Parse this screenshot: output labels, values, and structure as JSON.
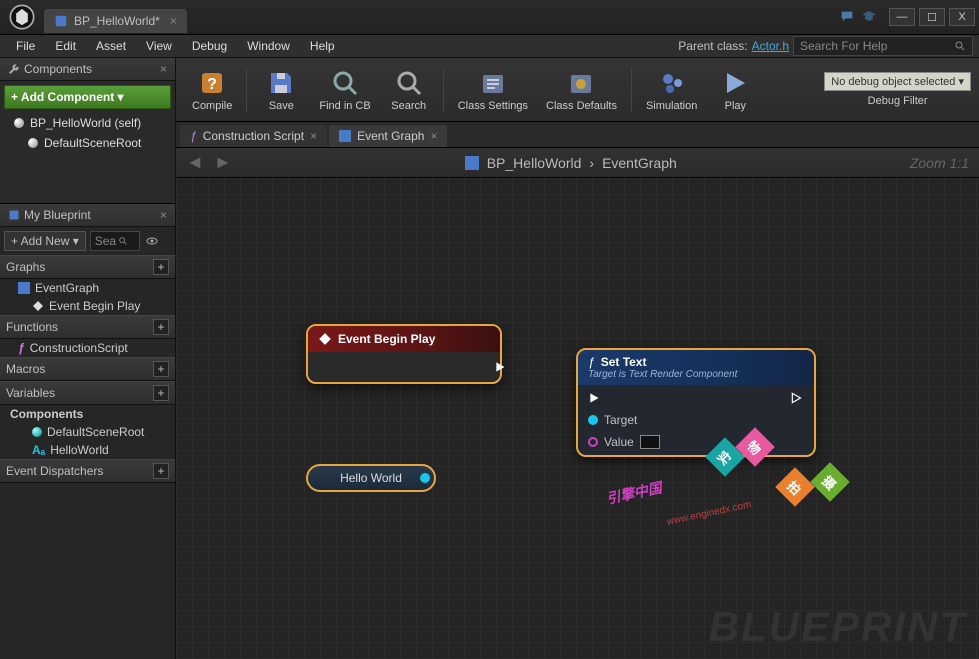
{
  "title_tab": "BP_HelloWorld*",
  "window_buttons": {
    "min": "—",
    "max": "☐",
    "close": "X"
  },
  "menubar": [
    "File",
    "Edit",
    "Asset",
    "View",
    "Debug",
    "Window",
    "Help"
  ],
  "parent_class_label": "Parent class:",
  "parent_class": "Actor.h",
  "search_help_placeholder": "Search For Help",
  "toolbar": {
    "compile": "Compile",
    "save": "Save",
    "find": "Find in CB",
    "search": "Search",
    "class_settings": "Class Settings",
    "class_defaults": "Class Defaults",
    "simulation": "Simulation",
    "play": "Play",
    "debug_select": "No debug object selected ▾",
    "debug_filter_label": "Debug Filter"
  },
  "components_panel": {
    "title": "Components",
    "add_btn": "+ Add Component ▾",
    "root": "BP_HelloWorld (self)",
    "child": "DefaultSceneRoot"
  },
  "my_blueprint": {
    "title": "My Blueprint",
    "add_new": "+ Add New ▾",
    "search_placeholder": "Sea",
    "sections": {
      "graphs": "Graphs",
      "functions": "Functions",
      "macros": "Macros",
      "variables": "Variables",
      "components_sub": "Components",
      "event_dispatchers": "Event Dispatchers"
    },
    "graph_items": {
      "event_graph": "EventGraph",
      "event_begin_play": "Event Begin Play"
    },
    "function_items": {
      "construction": "ConstructionScript"
    },
    "variable_items": {
      "root": "DefaultSceneRoot",
      "hello": "HelloWorld"
    }
  },
  "graph_tabs": {
    "construction": "Construction Script",
    "event_graph": "Event Graph"
  },
  "breadcrumb": {
    "root": "BP_HelloWorld",
    "current": "EventGraph"
  },
  "zoom": "Zoom 1:1",
  "nodes": {
    "event_begin_play": "Event Begin Play",
    "hello_world_var": "Hello World",
    "set_text": {
      "title": "Set Text",
      "subtitle": "Target is Text Render Component",
      "target": "Target",
      "value": "Value"
    }
  },
  "watermark_text": "BLUEPRINT",
  "overlay": {
    "b1": "实",
    "b2": "物",
    "b3": "拍",
    "b4": "摄",
    "text": "引擎中国",
    "url": "www.enginedx.com"
  }
}
